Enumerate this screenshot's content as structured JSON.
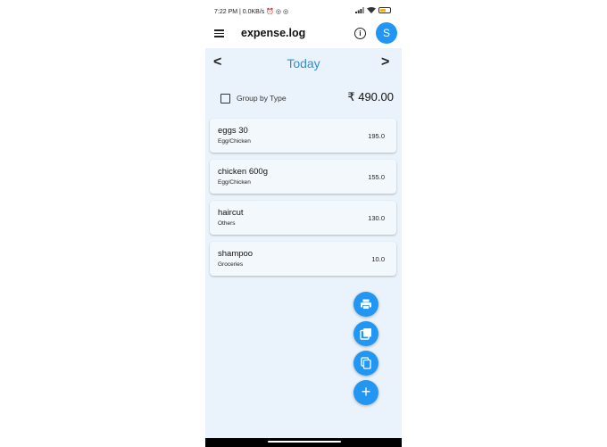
{
  "status_bar": {
    "text": "7:22 PM | 0.0KB/s ⏰ ◎ ◎"
  },
  "app_bar": {
    "title": "expense.log",
    "avatar_letter": "S",
    "info_glyph": "i"
  },
  "day_nav": {
    "title": "Today",
    "prev_glyph": "<",
    "next_glyph": ">"
  },
  "summary": {
    "group_label": "Group by Type",
    "total": "₹ 490.00",
    "group_checked": false
  },
  "expenses": [
    {
      "title": "eggs 30",
      "category": "Egg/Chicken",
      "amount": "195.0"
    },
    {
      "title": "chicken 600g",
      "category": "Egg/Chicken",
      "amount": "155.0"
    },
    {
      "title": "haircut",
      "category": "Others",
      "amount": "130.0"
    },
    {
      "title": "shampoo",
      "category": "Groceries",
      "amount": "10.0"
    }
  ],
  "fabs": {
    "icons": [
      "print-icon",
      "library-add-icon",
      "copy-icon",
      "add-icon"
    ],
    "add_glyph": "+"
  },
  "colors": {
    "accent": "#2196f3",
    "title_blue": "#2e8fd8",
    "background": "#eaf3fb"
  }
}
